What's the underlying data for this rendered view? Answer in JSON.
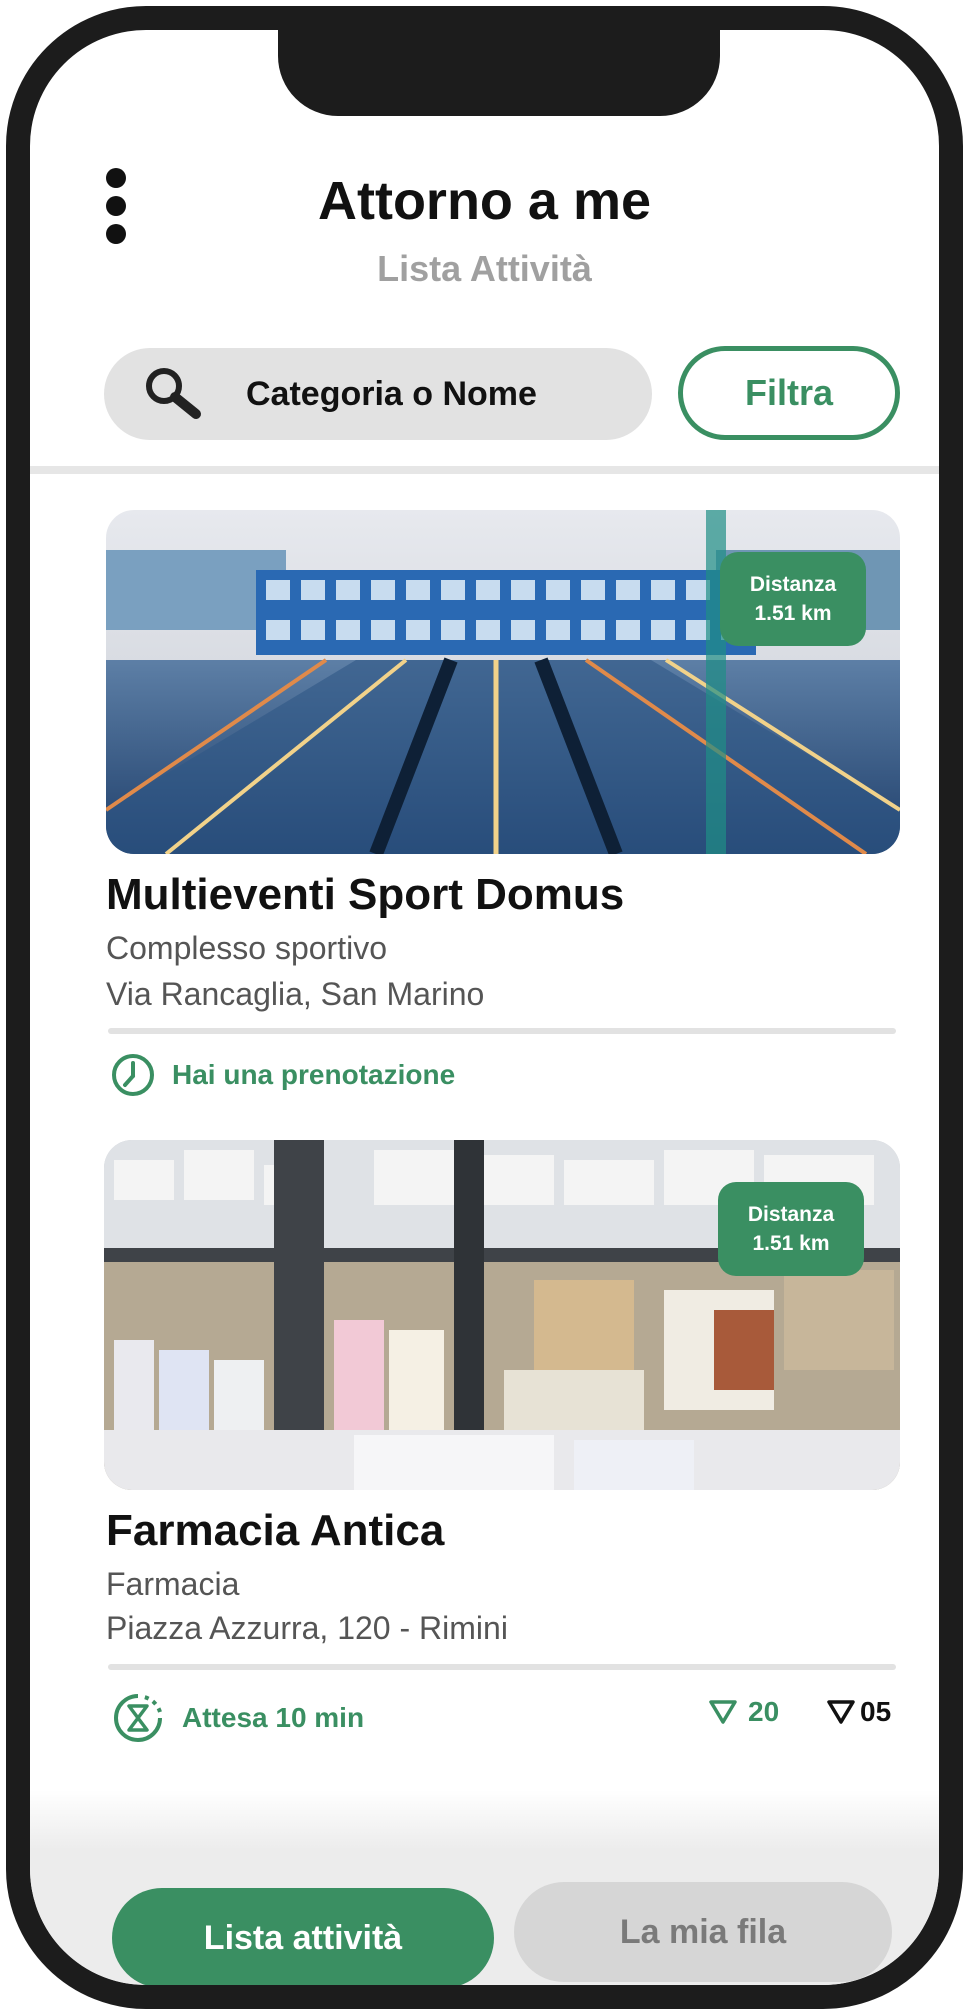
{
  "header": {
    "title": "Attorno a me",
    "subtitle": "Lista Attività",
    "menu_icon": "more-vertical-icon"
  },
  "search": {
    "placeholder": "Categoria o Nome",
    "icon": "search-icon",
    "filter_label": "Filtra"
  },
  "listings": [
    {
      "name": "Multieventi Sport Domus",
      "category": "Complesso sportivo",
      "address": "Via Rancaglia, San Marino",
      "image": "swimming-pool-photo",
      "distance_label": "Distanza",
      "distance_value": "1.51 km",
      "status_icon": "clock-icon",
      "status": "Hai una prenotazione"
    },
    {
      "name": "Farmacia Antica",
      "category": "Farmacia",
      "address": "Piazza Azzurra, 120 - Rimini",
      "image": "pharmacy-shelves-photo",
      "distance_label": "Distanza",
      "distance_value": "1.51 km",
      "status_icon": "hourglass-timer-icon",
      "status": "Attesa 10 min",
      "count_green": "20",
      "count_black": "05"
    }
  ],
  "bottom_nav": {
    "active_tab": "Lista attività",
    "inactive_tab": "La mia fila"
  },
  "colors": {
    "accent": "#3a8f62",
    "frame": "#1c1c1c",
    "muted": "#a0a0a0"
  }
}
